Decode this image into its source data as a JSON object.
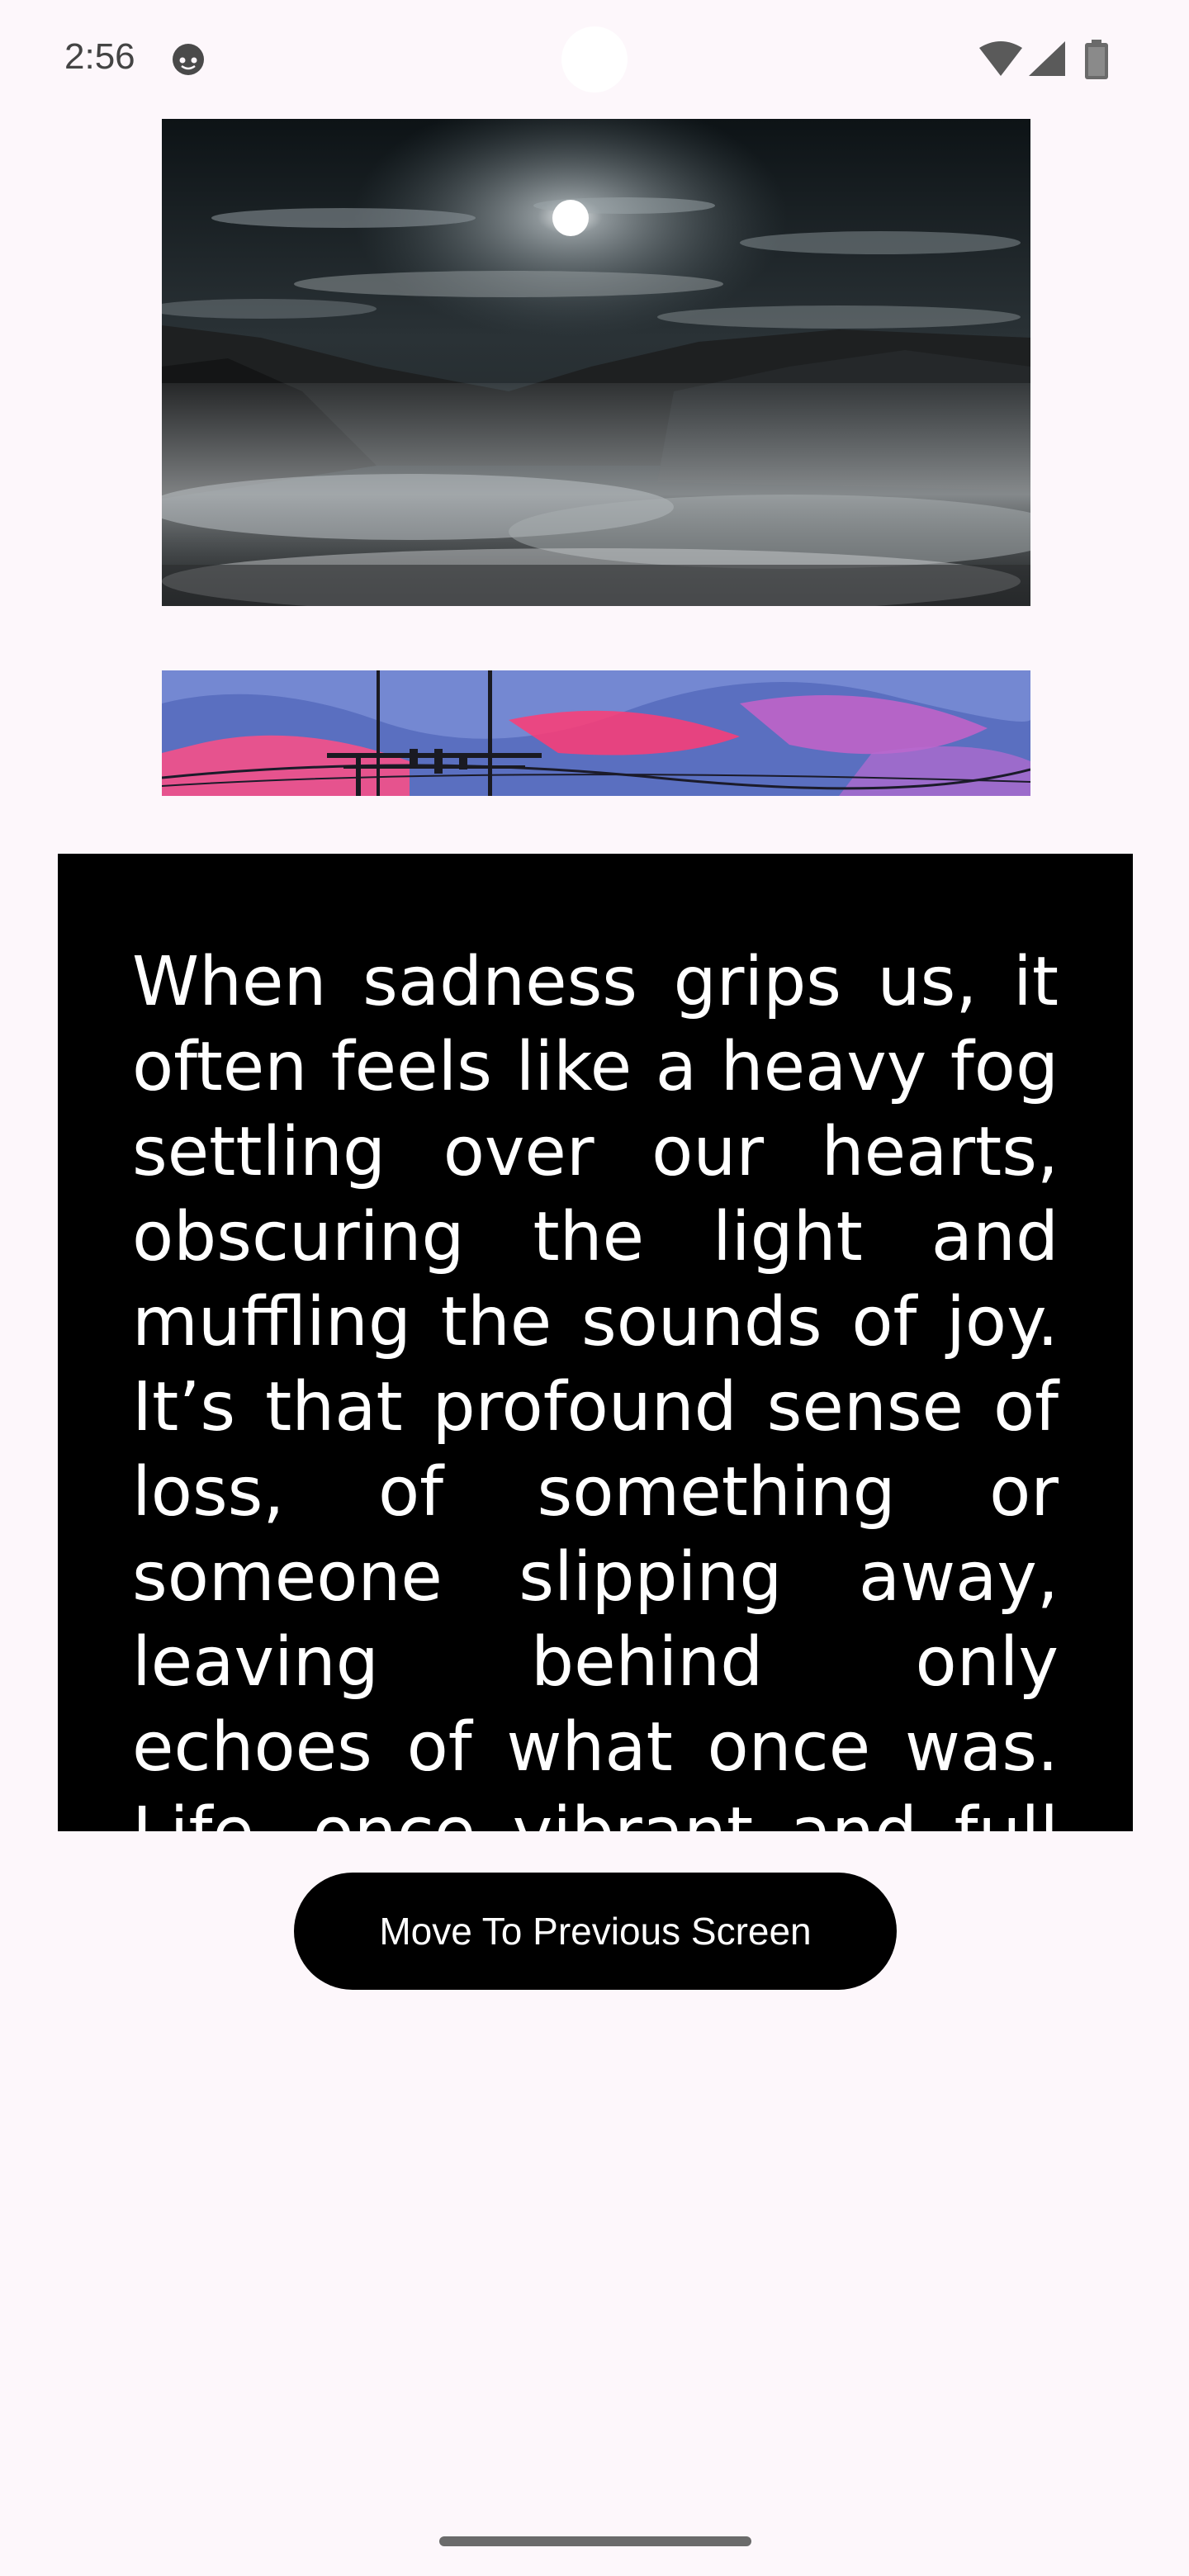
{
  "status_bar": {
    "time": "2:56",
    "icons": [
      "face-icon",
      "wifi-icon",
      "cell-signal-icon",
      "battery-icon"
    ]
  },
  "images": [
    {
      "name": "moonlit-mountain-clouds-image",
      "colors": {
        "sky": "#14191c",
        "cloud": "#9aa2a6",
        "moon": "#ffffff"
      }
    },
    {
      "name": "power-lines-sky-painting-image",
      "colors": {
        "sky": "#5a6fc0",
        "pink": "#ff3f78",
        "magenta": "#c85cc6"
      }
    }
  ],
  "main": {
    "paragraph": "When sadness grips us, it often feels like a heavy fog settling over our hearts, obscuring the light and muffling the sounds of joy. It’s that profound sense of loss, of something or someone slipping away, leaving behind only echoes of what once was. Life, once vibrant and full of"
  },
  "button": {
    "label": "Move To Previous Screen"
  },
  "colors": {
    "background": "#fdf7fb",
    "panel": "#000000",
    "button": "#000000",
    "button_text": "#ffffff"
  }
}
